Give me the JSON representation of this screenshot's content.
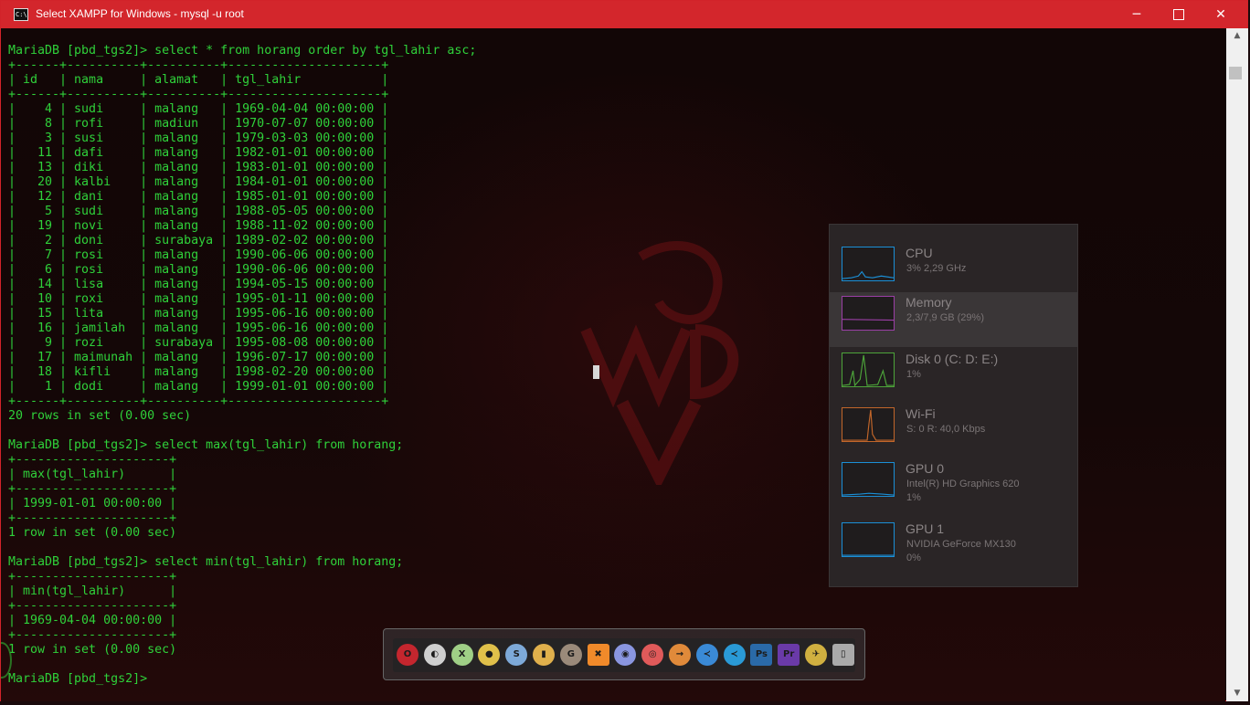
{
  "window": {
    "title": "Select XAMPP for Windows - mysql  -u root",
    "icon": "cmd-icon",
    "icon_text": "C:\\",
    "controls": {
      "minimize": "─",
      "close": "✕"
    }
  },
  "terminal": {
    "lines": [
      "MariaDB [pbd_tgs2]> select * from horang order by tgl_lahir asc;",
      "+------+----------+----------+---------------------+",
      "| id   | nama     | alamat   | tgl_lahir           |",
      "+------+----------+----------+---------------------+",
      "|    4 | sudi     | malang   | 1969-04-04 00:00:00 |",
      "|    8 | rofi     | madiun   | 1970-07-07 00:00:00 |",
      "|    3 | susi     | malang   | 1979-03-03 00:00:00 |",
      "|   11 | dafi     | malang   | 1982-01-01 00:00:00 |",
      "|   13 | diki     | malang   | 1983-01-01 00:00:00 |",
      "|   20 | kalbi    | malang   | 1984-01-01 00:00:00 |",
      "|   12 | dani     | malang   | 1985-01-01 00:00:00 |",
      "|    5 | sudi     | malang   | 1988-05-05 00:00:00 |",
      "|   19 | novi     | malang   | 1988-11-02 00:00:00 |",
      "|    2 | doni     | surabaya | 1989-02-02 00:00:00 |",
      "|    7 | rosi     | malang   | 1990-06-06 00:00:00 |",
      "|    6 | rosi     | malang   | 1990-06-06 00:00:00 |",
      "|   14 | lisa     | malang   | 1994-05-15 00:00:00 |",
      "|   10 | roxi     | malang   | 1995-01-11 00:00:00 |",
      "|   15 | lita     | malang   | 1995-06-16 00:00:00 |",
      "|   16 | jamilah  | malang   | 1995-06-16 00:00:00 |",
      "|    9 | rozi     | surabaya | 1995-08-08 00:00:00 |",
      "|   17 | maimunah | malang   | 1996-07-17 00:00:00 |",
      "|   18 | kifli    | malang   | 1998-02-20 00:00:00 |",
      "|    1 | dodi     | malang   | 1999-01-01 00:00:00 |",
      "+------+----------+----------+---------------------+",
      "20 rows in set (0.00 sec)",
      "",
      "MariaDB [pbd_tgs2]> select max(tgl_lahir) from horang;",
      "+---------------------+",
      "| max(tgl_lahir)      |",
      "+---------------------+",
      "| 1999-01-01 00:00:00 |",
      "+---------------------+",
      "1 row in set (0.00 sec)",
      "",
      "MariaDB [pbd_tgs2]> select min(tgl_lahir) from horang;",
      "+---------------------+",
      "| min(tgl_lahir)      |",
      "+---------------------+",
      "| 1969-04-04 00:00:00 |",
      "+---------------------+",
      "1 row in set (0.00 sec)",
      "",
      "MariaDB [pbd_tgs2]> "
    ],
    "text_color": "#2fd13a"
  },
  "scrollbar": {
    "up_arrow": "▲",
    "down_arrow": "▼"
  },
  "performance_widget": {
    "items": [
      {
        "name": "CPU",
        "detail": "3% 2,29 GHz",
        "detail2": "",
        "color": "#1b8fd6",
        "selected": false
      },
      {
        "name": "Memory",
        "detail": "2,3/7,9 GB (29%)",
        "detail2": "",
        "color": "#9b3fa6",
        "selected": true
      },
      {
        "name": "Disk 0 (C: D: E:)",
        "detail": "1%",
        "detail2": "",
        "color": "#4da43a",
        "selected": false
      },
      {
        "name": "Wi-Fi",
        "detail": "S: 0 R: 40,0 Kbps",
        "detail2": "",
        "color": "#c2662a",
        "selected": false
      },
      {
        "name": "GPU 0",
        "detail": "Intel(R) HD Graphics 620",
        "detail2": "1%",
        "color": "#1b8fd6",
        "selected": false
      },
      {
        "name": "GPU 1",
        "detail": "NVIDIA GeForce MX130",
        "detail2": "0%",
        "color": "#1b8fd6",
        "selected": false
      }
    ]
  },
  "dock": {
    "apps": [
      {
        "icon": "opera-icon",
        "glyph": "O",
        "color": "#c4262e"
      },
      {
        "icon": "obs-icon",
        "glyph": "◐",
        "color": "#cfcfcf"
      },
      {
        "icon": "xbox-icon",
        "glyph": "X",
        "color": "#9fcf86"
      },
      {
        "icon": "chrome-icon",
        "glyph": "●",
        "color": "#e0c04a"
      },
      {
        "icon": "steam-icon",
        "glyph": "S",
        "color": "#7da9d8"
      },
      {
        "icon": "folder-icon",
        "glyph": "▮",
        "color": "#e0b04c"
      },
      {
        "icon": "gimp-icon",
        "glyph": "G",
        "color": "#9a8a7a"
      },
      {
        "icon": "xampp-icon",
        "glyph": "✖",
        "color": "#f08a2a"
      },
      {
        "icon": "discord-icon",
        "glyph": "◉",
        "color": "#8a96e0"
      },
      {
        "icon": "record-icon",
        "glyph": "◎",
        "color": "#e05a5a"
      },
      {
        "icon": "arrow-icon",
        "glyph": "→",
        "color": "#e08a3a"
      },
      {
        "icon": "vscode-icon",
        "glyph": "≺",
        "color": "#3a8ad6"
      },
      {
        "icon": "vscode-insiders-icon",
        "glyph": "≺",
        "color": "#2a9ad6"
      },
      {
        "icon": "photoshop-icon",
        "glyph": "Ps",
        "color": "#2a6aa8"
      },
      {
        "icon": "premiere-icon",
        "glyph": "Pr",
        "color": "#6a3aa8"
      },
      {
        "icon": "bird-icon",
        "glyph": "✈",
        "color": "#d0b040"
      },
      {
        "icon": "trash-icon",
        "glyph": "▯",
        "color": "#aaaaaa"
      }
    ]
  }
}
